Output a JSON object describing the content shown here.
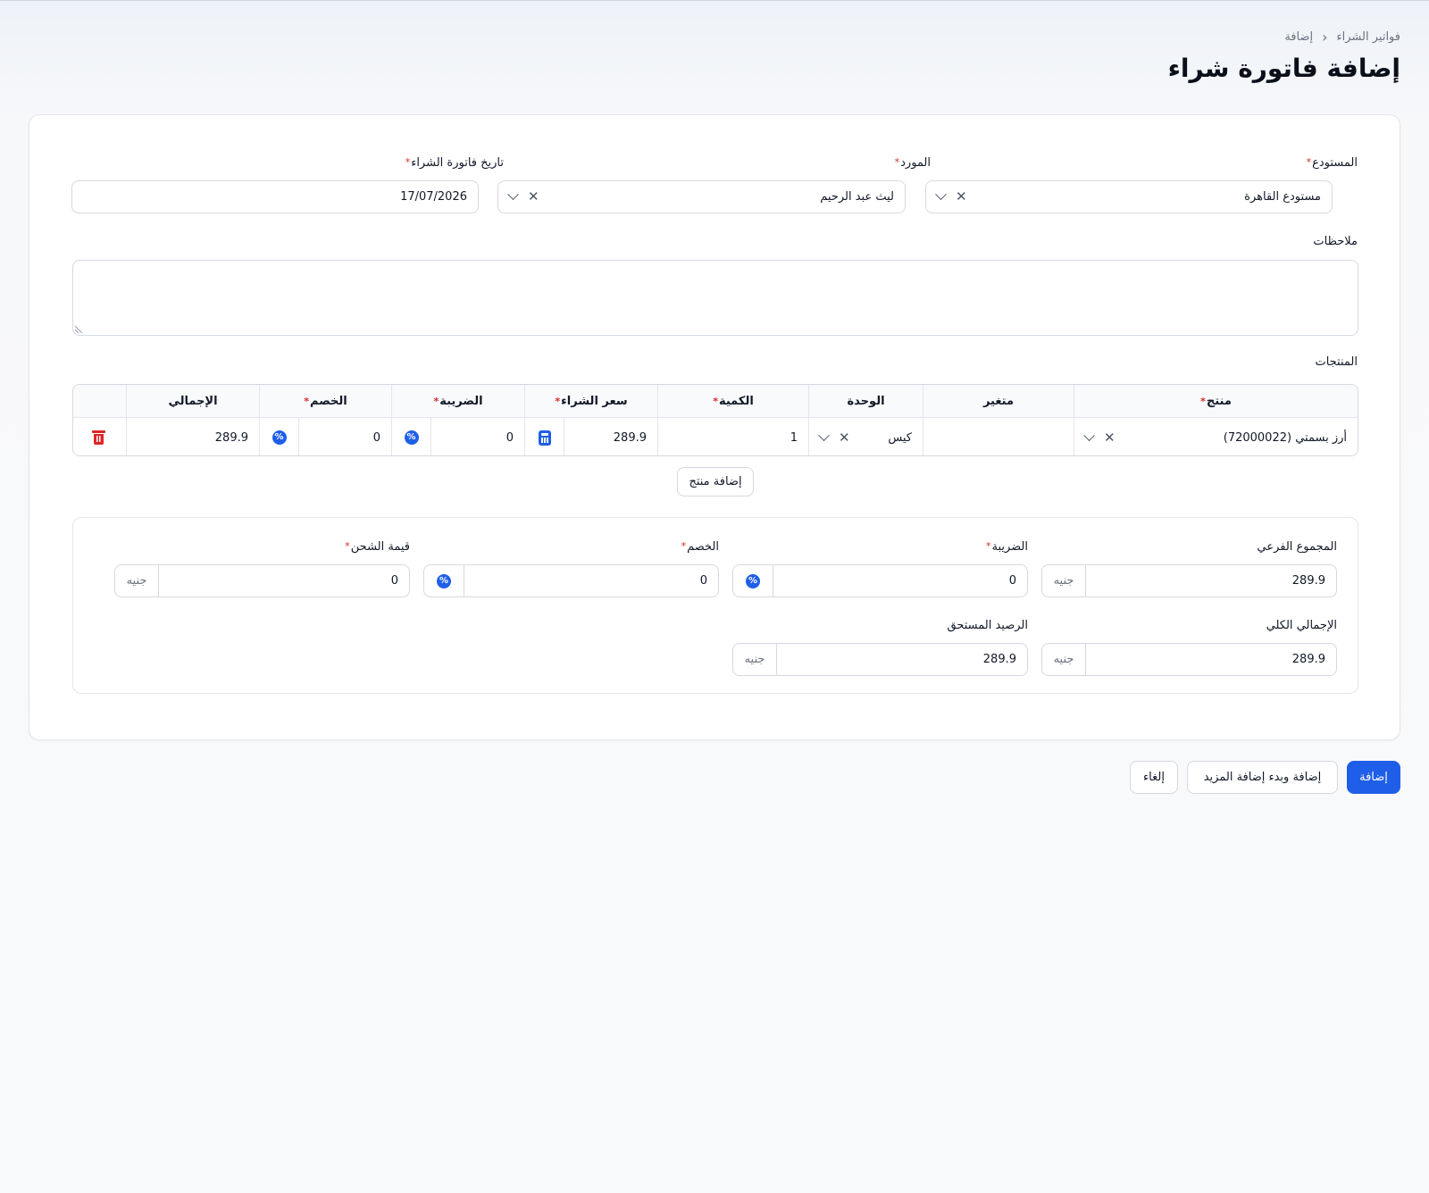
{
  "breadcrumb": {
    "parent": "فواتير الشراء",
    "current": "إضافة"
  },
  "page_title": "إضافة فاتورة شراء",
  "form": {
    "warehouse": {
      "label": "المستودع",
      "value": "مستودع القاهرة"
    },
    "supplier": {
      "label": "المورد",
      "value": "ليث عبد الرحيم"
    },
    "date": {
      "label": "تاريخ فاتورة الشراء",
      "value": "17/07/2026"
    },
    "notes": {
      "label": "ملاحظات",
      "value": ""
    }
  },
  "products": {
    "label": "المنتجات",
    "columns": {
      "product": "منتج",
      "variant": "متغير",
      "unit": "الوحدة",
      "quantity": "الكمية",
      "purchase_price": "سعر الشراء",
      "tax": "الضريبة",
      "discount": "الخصم",
      "total": "الإجمالي"
    },
    "rows": [
      {
        "product": "أرز بسمتي (72000022)",
        "variant": "",
        "unit": "كيس",
        "quantity": "1",
        "purchase_price": "289.9",
        "tax": "0",
        "discount": "0",
        "total": "289.9"
      }
    ],
    "add_button": "إضافة منتج"
  },
  "totals": {
    "currency": "جنيه",
    "subtotal": {
      "label": "المجموع الفرعي",
      "value": "289.9"
    },
    "tax": {
      "label": "الضريبة",
      "value": "0"
    },
    "discount": {
      "label": "الخصم",
      "value": "0"
    },
    "shipping": {
      "label": "قيمة الشحن",
      "value": "0"
    },
    "grand_total": {
      "label": "الإجمالي الكلي",
      "value": "289.9"
    },
    "balance_due": {
      "label": "الرصيد المستحق",
      "value": "289.9"
    }
  },
  "actions": {
    "add": "إضافة",
    "add_and_more": "إضافة وبدء إضافة المزيد",
    "cancel": "إلغاء"
  },
  "colors": {
    "primary": "#1f5ee8",
    "danger": "#dc2626",
    "required": "#dc2626"
  },
  "icons": {
    "clear": "close-icon",
    "dropdown": "chevron-down-icon",
    "percent": "percent-icon",
    "calculator": "calculator-icon",
    "delete": "trash-icon"
  }
}
